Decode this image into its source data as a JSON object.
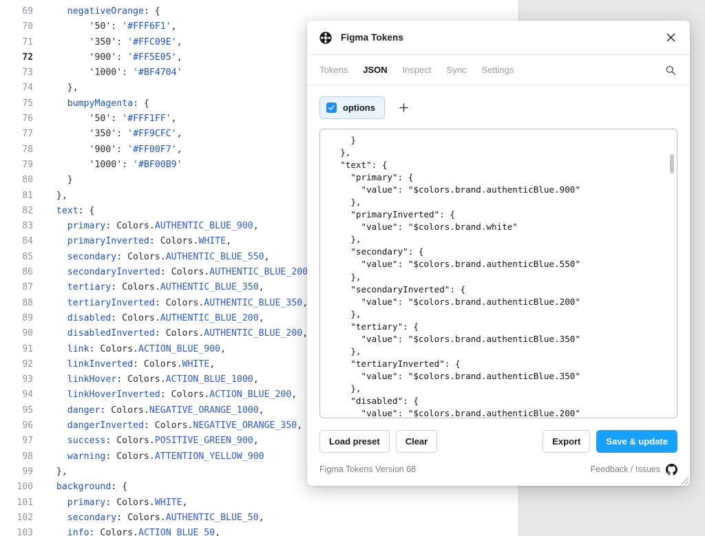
{
  "editor": {
    "lines": [
      {
        "num": "69",
        "active": false,
        "indent": 4,
        "tokens": [
          {
            "t": "negativeOrange",
            "c": "tk-key"
          },
          {
            "t": ": {",
            "c": "tk-punct"
          }
        ]
      },
      {
        "num": "70",
        "active": false,
        "indent": 8,
        "tokens": [
          {
            "t": "'50'",
            "c": "tk-plain"
          },
          {
            "t": ": ",
            "c": "tk-punct"
          },
          {
            "t": "'#FFF6F1'",
            "c": "tk-str"
          },
          {
            "t": ",",
            "c": "tk-punct"
          }
        ]
      },
      {
        "num": "71",
        "active": false,
        "indent": 8,
        "tokens": [
          {
            "t": "'350'",
            "c": "tk-plain"
          },
          {
            "t": ": ",
            "c": "tk-punct"
          },
          {
            "t": "'#FFC09E'",
            "c": "tk-str"
          },
          {
            "t": ",",
            "c": "tk-punct"
          }
        ]
      },
      {
        "num": "72",
        "active": true,
        "indent": 8,
        "tokens": [
          {
            "t": "'900'",
            "c": "tk-plain"
          },
          {
            "t": ": ",
            "c": "tk-punct"
          },
          {
            "t": "'#FF5E05'",
            "c": "tk-str"
          },
          {
            "t": ",",
            "c": "tk-punct"
          }
        ]
      },
      {
        "num": "73",
        "active": false,
        "indent": 8,
        "tokens": [
          {
            "t": "'1000'",
            "c": "tk-plain"
          },
          {
            "t": ": ",
            "c": "tk-punct"
          },
          {
            "t": "'#BF4704'",
            "c": "tk-str"
          }
        ]
      },
      {
        "num": "74",
        "active": false,
        "indent": 4,
        "tokens": [
          {
            "t": "},",
            "c": "tk-punct"
          }
        ]
      },
      {
        "num": "75",
        "active": false,
        "indent": 4,
        "tokens": [
          {
            "t": "bumpyMagenta",
            "c": "tk-key"
          },
          {
            "t": ": {",
            "c": "tk-punct"
          }
        ]
      },
      {
        "num": "76",
        "active": false,
        "indent": 8,
        "tokens": [
          {
            "t": "'50'",
            "c": "tk-plain"
          },
          {
            "t": ": ",
            "c": "tk-punct"
          },
          {
            "t": "'#FFF1FF'",
            "c": "tk-str"
          },
          {
            "t": ",",
            "c": "tk-punct"
          }
        ]
      },
      {
        "num": "77",
        "active": false,
        "indent": 8,
        "tokens": [
          {
            "t": "'350'",
            "c": "tk-plain"
          },
          {
            "t": ": ",
            "c": "tk-punct"
          },
          {
            "t": "'#FF9CFC'",
            "c": "tk-str"
          },
          {
            "t": ",",
            "c": "tk-punct"
          }
        ]
      },
      {
        "num": "78",
        "active": false,
        "indent": 8,
        "tokens": [
          {
            "t": "'900'",
            "c": "tk-plain"
          },
          {
            "t": ": ",
            "c": "tk-punct"
          },
          {
            "t": "'#FF00F7'",
            "c": "tk-str"
          },
          {
            "t": ",",
            "c": "tk-punct"
          }
        ]
      },
      {
        "num": "79",
        "active": false,
        "indent": 8,
        "tokens": [
          {
            "t": "'1000'",
            "c": "tk-plain"
          },
          {
            "t": ": ",
            "c": "tk-punct"
          },
          {
            "t": "'#BF00B9'",
            "c": "tk-str"
          }
        ]
      },
      {
        "num": "80",
        "active": false,
        "indent": 4,
        "tokens": [
          {
            "t": "}",
            "c": "tk-punct"
          }
        ]
      },
      {
        "num": "81",
        "active": false,
        "indent": 2,
        "tokens": [
          {
            "t": "},",
            "c": "tk-punct"
          }
        ]
      },
      {
        "num": "82",
        "active": false,
        "indent": 2,
        "tokens": [
          {
            "t": "text",
            "c": "tk-key"
          },
          {
            "t": ": {",
            "c": "tk-punct"
          }
        ]
      },
      {
        "num": "83",
        "active": false,
        "indent": 4,
        "tokens": [
          {
            "t": "primary",
            "c": "tk-prop"
          },
          {
            "t": ": Colors.",
            "c": "tk-punct"
          },
          {
            "t": "AUTHENTIC_BLUE_900",
            "c": "tk-const"
          },
          {
            "t": ",",
            "c": "tk-punct"
          }
        ]
      },
      {
        "num": "84",
        "active": false,
        "indent": 4,
        "tokens": [
          {
            "t": "primaryInverted",
            "c": "tk-prop"
          },
          {
            "t": ": Colors.",
            "c": "tk-punct"
          },
          {
            "t": "WHITE",
            "c": "tk-const"
          },
          {
            "t": ",",
            "c": "tk-punct"
          }
        ]
      },
      {
        "num": "85",
        "active": false,
        "indent": 4,
        "tokens": [
          {
            "t": "secondary",
            "c": "tk-prop"
          },
          {
            "t": ": Colors.",
            "c": "tk-punct"
          },
          {
            "t": "AUTHENTIC_BLUE_550",
            "c": "tk-const"
          },
          {
            "t": ",",
            "c": "tk-punct"
          }
        ]
      },
      {
        "num": "86",
        "active": false,
        "indent": 4,
        "tokens": [
          {
            "t": "secondaryInverted",
            "c": "tk-prop"
          },
          {
            "t": ": Colors.",
            "c": "tk-punct"
          },
          {
            "t": "AUTHENTIC_BLUE_200",
            "c": "tk-const"
          },
          {
            "t": ",",
            "c": "tk-punct"
          }
        ]
      },
      {
        "num": "87",
        "active": false,
        "indent": 4,
        "tokens": [
          {
            "t": "tertiary",
            "c": "tk-prop"
          },
          {
            "t": ": Colors.",
            "c": "tk-punct"
          },
          {
            "t": "AUTHENTIC_BLUE_350",
            "c": "tk-const"
          },
          {
            "t": ",",
            "c": "tk-punct"
          }
        ]
      },
      {
        "num": "88",
        "active": false,
        "indent": 4,
        "tokens": [
          {
            "t": "tertiaryInverted",
            "c": "tk-prop"
          },
          {
            "t": ": Colors.",
            "c": "tk-punct"
          },
          {
            "t": "AUTHENTIC_BLUE_350",
            "c": "tk-const"
          },
          {
            "t": ",",
            "c": "tk-punct"
          }
        ]
      },
      {
        "num": "89",
        "active": false,
        "indent": 4,
        "tokens": [
          {
            "t": "disabled",
            "c": "tk-prop"
          },
          {
            "t": ": Colors.",
            "c": "tk-punct"
          },
          {
            "t": "AUTHENTIC_BLUE_200",
            "c": "tk-const"
          },
          {
            "t": ",",
            "c": "tk-punct"
          }
        ]
      },
      {
        "num": "90",
        "active": false,
        "indent": 4,
        "tokens": [
          {
            "t": "disabledInverted",
            "c": "tk-prop"
          },
          {
            "t": ": Colors.",
            "c": "tk-punct"
          },
          {
            "t": "AUTHENTIC_BLUE_200",
            "c": "tk-const"
          },
          {
            "t": ",",
            "c": "tk-punct"
          }
        ]
      },
      {
        "num": "91",
        "active": false,
        "indent": 4,
        "tokens": [
          {
            "t": "link",
            "c": "tk-prop"
          },
          {
            "t": ": Colors.",
            "c": "tk-punct"
          },
          {
            "t": "ACTION_BLUE_900",
            "c": "tk-const"
          },
          {
            "t": ",",
            "c": "tk-punct"
          }
        ]
      },
      {
        "num": "92",
        "active": false,
        "indent": 4,
        "tokens": [
          {
            "t": "linkInverted",
            "c": "tk-prop"
          },
          {
            "t": ": Colors.",
            "c": "tk-punct"
          },
          {
            "t": "WHITE",
            "c": "tk-const"
          },
          {
            "t": ",",
            "c": "tk-punct"
          }
        ]
      },
      {
        "num": "93",
        "active": false,
        "indent": 4,
        "tokens": [
          {
            "t": "linkHover",
            "c": "tk-prop"
          },
          {
            "t": ": Colors.",
            "c": "tk-punct"
          },
          {
            "t": "ACTION_BLUE_1000",
            "c": "tk-const"
          },
          {
            "t": ",",
            "c": "tk-punct"
          }
        ]
      },
      {
        "num": "94",
        "active": false,
        "indent": 4,
        "tokens": [
          {
            "t": "linkHoverInverted",
            "c": "tk-prop"
          },
          {
            "t": ": Colors.",
            "c": "tk-punct"
          },
          {
            "t": "ACTION_BLUE_200",
            "c": "tk-const"
          },
          {
            "t": ",",
            "c": "tk-punct"
          }
        ]
      },
      {
        "num": "95",
        "active": false,
        "indent": 4,
        "tokens": [
          {
            "t": "danger",
            "c": "tk-prop"
          },
          {
            "t": ": Colors.",
            "c": "tk-punct"
          },
          {
            "t": "NEGATIVE_ORANGE_1000",
            "c": "tk-const"
          },
          {
            "t": ",",
            "c": "tk-punct"
          }
        ]
      },
      {
        "num": "96",
        "active": false,
        "indent": 4,
        "tokens": [
          {
            "t": "dangerInverted",
            "c": "tk-prop"
          },
          {
            "t": ": Colors.",
            "c": "tk-punct"
          },
          {
            "t": "NEGATIVE_ORANGE_350",
            "c": "tk-const"
          },
          {
            "t": ",",
            "c": "tk-punct"
          }
        ]
      },
      {
        "num": "97",
        "active": false,
        "indent": 4,
        "tokens": [
          {
            "t": "success",
            "c": "tk-prop"
          },
          {
            "t": ": Colors.",
            "c": "tk-punct"
          },
          {
            "t": "POSITIVE_GREEN_900",
            "c": "tk-const"
          },
          {
            "t": ",",
            "c": "tk-punct"
          }
        ]
      },
      {
        "num": "98",
        "active": false,
        "indent": 4,
        "tokens": [
          {
            "t": "warning",
            "c": "tk-prop"
          },
          {
            "t": ": Colors.",
            "c": "tk-punct"
          },
          {
            "t": "ATTENTION_YELLOW_900",
            "c": "tk-const"
          }
        ]
      },
      {
        "num": "99",
        "active": false,
        "indent": 2,
        "tokens": [
          {
            "t": "},",
            "c": "tk-punct"
          }
        ]
      },
      {
        "num": "100",
        "active": false,
        "indent": 2,
        "tokens": [
          {
            "t": "background",
            "c": "tk-key"
          },
          {
            "t": ": {",
            "c": "tk-punct"
          }
        ]
      },
      {
        "num": "101",
        "active": false,
        "indent": 4,
        "tokens": [
          {
            "t": "primary",
            "c": "tk-prop"
          },
          {
            "t": ": Colors.",
            "c": "tk-punct"
          },
          {
            "t": "WHITE",
            "c": "tk-const"
          },
          {
            "t": ",",
            "c": "tk-punct"
          }
        ]
      },
      {
        "num": "102",
        "active": false,
        "indent": 4,
        "tokens": [
          {
            "t": "secondary",
            "c": "tk-prop"
          },
          {
            "t": ": Colors.",
            "c": "tk-punct"
          },
          {
            "t": "AUTHENTIC_BLUE_50",
            "c": "tk-const"
          },
          {
            "t": ",",
            "c": "tk-punct"
          }
        ]
      },
      {
        "num": "103",
        "active": false,
        "indent": 4,
        "tokens": [
          {
            "t": "info",
            "c": "tk-prop"
          },
          {
            "t": ": Colors.",
            "c": "tk-punct"
          },
          {
            "t": "ACTION_BLUE_50",
            "c": "tk-const"
          },
          {
            "t": ",",
            "c": "tk-punct"
          }
        ]
      }
    ]
  },
  "plugin": {
    "title": "Figma Tokens",
    "icon": "figma-tokens-logo-icon",
    "close_icon": "close-icon",
    "tabs": [
      {
        "label": "Tokens",
        "active": false
      },
      {
        "label": "JSON",
        "active": true
      },
      {
        "label": "Inspect",
        "active": false
      },
      {
        "label": "Sync",
        "active": false
      },
      {
        "label": "Settings",
        "active": false
      }
    ],
    "search_icon": "search-icon",
    "chips": {
      "options": {
        "label": "options",
        "checked": true
      },
      "add_label": "+"
    },
    "json_content": "    }\n  },\n  \"text\": {\n    \"primary\": {\n      \"value\": \"$colors.brand.authenticBlue.900\"\n    },\n    \"primaryInverted\": {\n      \"value\": \"$colors.brand.white\"\n    },\n    \"secondary\": {\n      \"value\": \"$colors.brand.authenticBlue.550\"\n    },\n    \"secondaryInverted\": {\n      \"value\": \"$colors.brand.authenticBlue.200\"\n    },\n    \"tertiary\": {\n      \"value\": \"$colors.brand.authenticBlue.350\"\n    },\n    \"tertiaryInverted\": {\n      \"value\": \"$colors.brand.authenticBlue.350\"\n    },\n    \"disabled\": {\n      \"value\": \"$colors.brand.authenticBlue.200\"",
    "actions": {
      "load_preset": "Load preset",
      "clear": "Clear",
      "export": "Export",
      "save_update": "Save & update"
    },
    "footer": {
      "version": "Figma Tokens Version 68",
      "feedback": "Feedback / Issues",
      "github_icon": "github-icon"
    },
    "accent_color": "#18A0FB"
  }
}
